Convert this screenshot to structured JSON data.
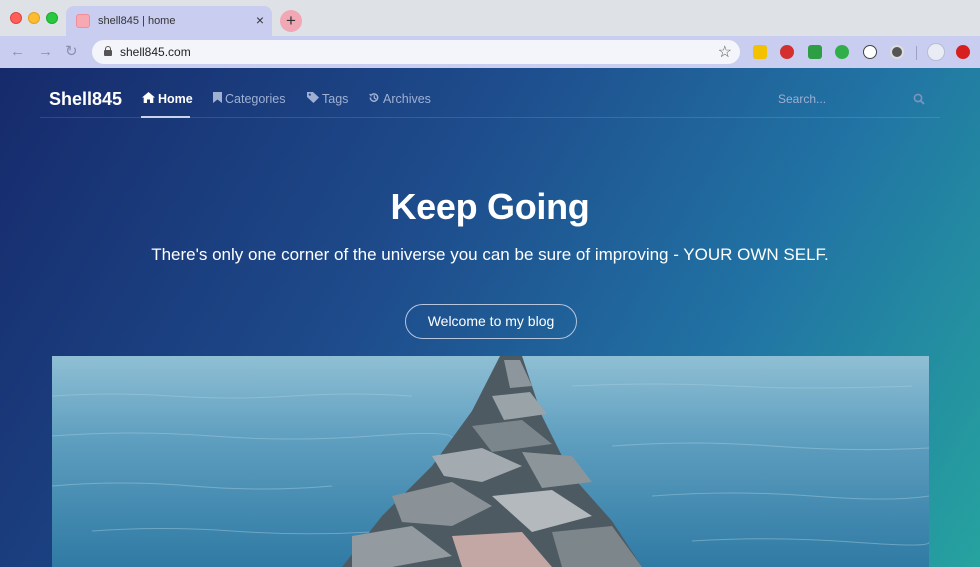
{
  "browser": {
    "tab_title": "shell845 | home",
    "tab_close": "×",
    "new_tab": "+",
    "url": "shell845.com",
    "back": "←",
    "forward": "→",
    "reload": "↻",
    "bookmark_star": "☆"
  },
  "site": {
    "brand": "Shell845",
    "nav": [
      {
        "label": "Home",
        "icon": "home-icon",
        "active": true
      },
      {
        "label": "Categories",
        "icon": "bookmark-icon",
        "active": false
      },
      {
        "label": "Tags",
        "icon": "tag-icon",
        "active": false
      },
      {
        "label": "Archives",
        "icon": "history-icon",
        "active": false
      }
    ],
    "search_placeholder": "Search..."
  },
  "hero": {
    "title": "Keep Going",
    "subtitle": "There's only one corner of the universe you can be sure of improving - YOUR OWN SELF.",
    "button_label": "Welcome to my blog"
  },
  "colors": {
    "gradient_start": "#162a6b",
    "gradient_end": "#26a39f",
    "text": "#ffffff"
  }
}
